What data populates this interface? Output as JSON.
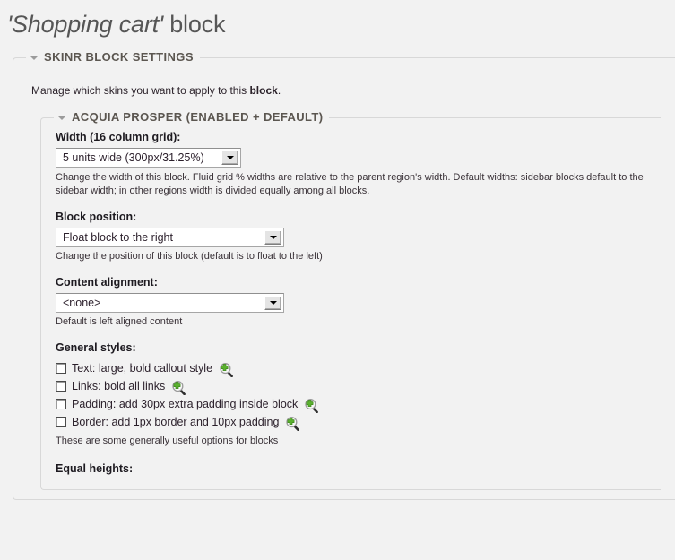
{
  "page": {
    "title_quoted": "'Shopping cart'",
    "title_plain": " block"
  },
  "outer_fieldset": {
    "legend": "SKINR BLOCK SETTINGS",
    "intro_before": "Manage which skins you want to apply to this ",
    "intro_bold": "block",
    "intro_after": "."
  },
  "inner_fieldset": {
    "legend": "ACQUIA PROSPER (ENABLED + DEFAULT)"
  },
  "fields": {
    "width": {
      "label": "Width (16 column grid):",
      "value": "5 units wide (300px/31.25%)",
      "description": "Change the width of this block. Fluid grid % widths are relative to the parent region's width. Default widths: sidebar blocks default to the sidebar width; in other regions width is divided equally among all blocks."
    },
    "block_position": {
      "label": "Block position:",
      "value": "Float block to the right",
      "description": "Change the position of this block (default is to float to the left)"
    },
    "content_alignment": {
      "label": "Content alignment:",
      "value": "<none>",
      "description": "Default is left aligned content"
    }
  },
  "general_styles": {
    "label": "General styles:",
    "options": [
      {
        "label": "Text: large, bold callout style",
        "checked": false,
        "icon": "zoom-in-icon"
      },
      {
        "label": "Links: bold all links",
        "checked": false,
        "icon": "zoom-in-icon"
      },
      {
        "label": "Padding: add 30px extra padding inside block",
        "checked": false,
        "icon": "zoom-in-icon"
      },
      {
        "label": "Border: add 1px border and 10px padding",
        "checked": false,
        "icon": "zoom-in-icon"
      }
    ],
    "description": "These are some generally useful options for blocks"
  },
  "equal_heights": {
    "label": "Equal heights:"
  },
  "colors": {
    "page_bg": "#f2f2f2",
    "title": "#565656",
    "legend": "#5b5650",
    "border": "#d8d8d8",
    "icon_green": "#5bb12f"
  }
}
